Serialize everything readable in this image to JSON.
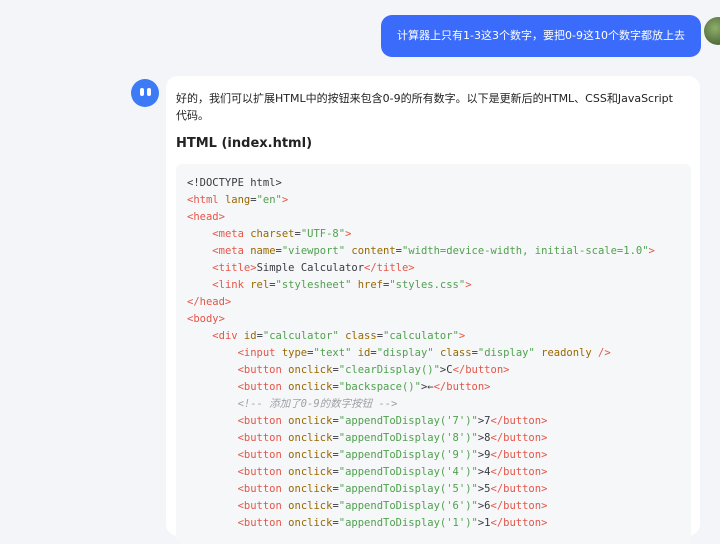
{
  "user_message": {
    "text": "计算器上只有1-3这3个数字，要把0-9这10个数字都放上去"
  },
  "assistant_message": {
    "intro": "好的，我们可以扩展HTML中的按钮来包含0-9的所有数字。以下是更新后的HTML、CSS和JavaScript代码。",
    "section_title": "HTML (index.html)",
    "code_lines": [
      [
        [
          "p",
          "<!DOCTYPE html>"
        ]
      ],
      [
        [
          "t",
          "<html"
        ],
        [
          "p",
          " "
        ],
        [
          "a",
          "lang"
        ],
        [
          "p",
          "="
        ],
        [
          "s",
          "\"en\""
        ],
        [
          "t",
          ">"
        ]
      ],
      [
        [
          "t",
          "<head>"
        ]
      ],
      [
        [
          "p",
          "    "
        ],
        [
          "t",
          "<meta"
        ],
        [
          "p",
          " "
        ],
        [
          "a",
          "charset"
        ],
        [
          "p",
          "="
        ],
        [
          "s",
          "\"UTF-8\""
        ],
        [
          "t",
          ">"
        ]
      ],
      [
        [
          "p",
          "    "
        ],
        [
          "t",
          "<meta"
        ],
        [
          "p",
          " "
        ],
        [
          "a",
          "name"
        ],
        [
          "p",
          "="
        ],
        [
          "s",
          "\"viewport\""
        ],
        [
          "p",
          " "
        ],
        [
          "a",
          "content"
        ],
        [
          "p",
          "="
        ],
        [
          "s",
          "\"width=device-width, initial-scale=1.0\""
        ],
        [
          "t",
          ">"
        ]
      ],
      [
        [
          "p",
          "    "
        ],
        [
          "t",
          "<title>"
        ],
        [
          "p",
          "Simple Calculator"
        ],
        [
          "t",
          "</title>"
        ]
      ],
      [
        [
          "p",
          "    "
        ],
        [
          "t",
          "<link"
        ],
        [
          "p",
          " "
        ],
        [
          "a",
          "rel"
        ],
        [
          "p",
          "="
        ],
        [
          "s",
          "\"stylesheet\""
        ],
        [
          "p",
          " "
        ],
        [
          "a",
          "href"
        ],
        [
          "p",
          "="
        ],
        [
          "s",
          "\"styles.css\""
        ],
        [
          "t",
          ">"
        ]
      ],
      [
        [
          "t",
          "</head>"
        ]
      ],
      [
        [
          "t",
          "<body>"
        ]
      ],
      [
        [
          "p",
          "    "
        ],
        [
          "t",
          "<div"
        ],
        [
          "p",
          " "
        ],
        [
          "a",
          "id"
        ],
        [
          "p",
          "="
        ],
        [
          "s",
          "\"calculator\""
        ],
        [
          "p",
          " "
        ],
        [
          "a",
          "class"
        ],
        [
          "p",
          "="
        ],
        [
          "s",
          "\"calculator\""
        ],
        [
          "t",
          ">"
        ]
      ],
      [
        [
          "p",
          "        "
        ],
        [
          "t",
          "<input"
        ],
        [
          "p",
          " "
        ],
        [
          "a",
          "type"
        ],
        [
          "p",
          "="
        ],
        [
          "s",
          "\"text\""
        ],
        [
          "p",
          " "
        ],
        [
          "a",
          "id"
        ],
        [
          "p",
          "="
        ],
        [
          "s",
          "\"display\""
        ],
        [
          "p",
          " "
        ],
        [
          "a",
          "class"
        ],
        [
          "p",
          "="
        ],
        [
          "s",
          "\"display\""
        ],
        [
          "p",
          " "
        ],
        [
          "a",
          "readonly"
        ],
        [
          "p",
          " "
        ],
        [
          "t",
          "/>"
        ]
      ],
      [
        [
          "p",
          "        "
        ],
        [
          "t",
          "<button"
        ],
        [
          "p",
          " "
        ],
        [
          "a",
          "onclick"
        ],
        [
          "p",
          "="
        ],
        [
          "s",
          "\"clearDisplay()\""
        ],
        [
          "p",
          ">C"
        ],
        [
          "t",
          "</button>"
        ]
      ],
      [
        [
          "p",
          "        "
        ],
        [
          "t",
          "<button"
        ],
        [
          "p",
          " "
        ],
        [
          "a",
          "onclick"
        ],
        [
          "p",
          "="
        ],
        [
          "s",
          "\"backspace()\""
        ],
        [
          "p",
          ">&larr;"
        ],
        [
          "t",
          "</button>"
        ]
      ],
      [
        [
          "p",
          "        "
        ],
        [
          "c",
          "<!-- 添加了0-9的数字按钮 -->"
        ]
      ],
      [
        [
          "p",
          "        "
        ],
        [
          "t",
          "<button"
        ],
        [
          "p",
          " "
        ],
        [
          "a",
          "onclick"
        ],
        [
          "p",
          "="
        ],
        [
          "s",
          "\"appendToDisplay('7')\""
        ],
        [
          "p",
          ">7"
        ],
        [
          "t",
          "</button>"
        ]
      ],
      [
        [
          "p",
          "        "
        ],
        [
          "t",
          "<button"
        ],
        [
          "p",
          " "
        ],
        [
          "a",
          "onclick"
        ],
        [
          "p",
          "="
        ],
        [
          "s",
          "\"appendToDisplay('8')\""
        ],
        [
          "p",
          ">8"
        ],
        [
          "t",
          "</button>"
        ]
      ],
      [
        [
          "p",
          "        "
        ],
        [
          "t",
          "<button"
        ],
        [
          "p",
          " "
        ],
        [
          "a",
          "onclick"
        ],
        [
          "p",
          "="
        ],
        [
          "s",
          "\"appendToDisplay('9')\""
        ],
        [
          "p",
          ">9"
        ],
        [
          "t",
          "</button>"
        ]
      ],
      [
        [
          "p",
          "        "
        ],
        [
          "t",
          "<button"
        ],
        [
          "p",
          " "
        ],
        [
          "a",
          "onclick"
        ],
        [
          "p",
          "="
        ],
        [
          "s",
          "\"appendToDisplay('4')\""
        ],
        [
          "p",
          ">4"
        ],
        [
          "t",
          "</button>"
        ]
      ],
      [
        [
          "p",
          "        "
        ],
        [
          "t",
          "<button"
        ],
        [
          "p",
          " "
        ],
        [
          "a",
          "onclick"
        ],
        [
          "p",
          "="
        ],
        [
          "s",
          "\"appendToDisplay('5')\""
        ],
        [
          "p",
          ">5"
        ],
        [
          "t",
          "</button>"
        ]
      ],
      [
        [
          "p",
          "        "
        ],
        [
          "t",
          "<button"
        ],
        [
          "p",
          " "
        ],
        [
          "a",
          "onclick"
        ],
        [
          "p",
          "="
        ],
        [
          "s",
          "\"appendToDisplay('6')\""
        ],
        [
          "p",
          ">6"
        ],
        [
          "t",
          "</button>"
        ]
      ],
      [
        [
          "p",
          "        "
        ],
        [
          "t",
          "<button"
        ],
        [
          "p",
          " "
        ],
        [
          "a",
          "onclick"
        ],
        [
          "p",
          "="
        ],
        [
          "s",
          "\"appendToDisplay('1')\""
        ],
        [
          "p",
          ">1"
        ],
        [
          "t",
          "</button>"
        ]
      ]
    ]
  },
  "colors": {
    "user_bubble": "#3a6bfa",
    "bot_avatar": "#3c7bf5",
    "page_background": "#f4f5f8",
    "tag": "#e45649",
    "attr": "#986801",
    "string": "#50a14f",
    "comment": "#a0a1a7"
  },
  "icons": {
    "user_avatar": "user-avatar-photo",
    "assistant_avatar": "robot-face-icon"
  }
}
